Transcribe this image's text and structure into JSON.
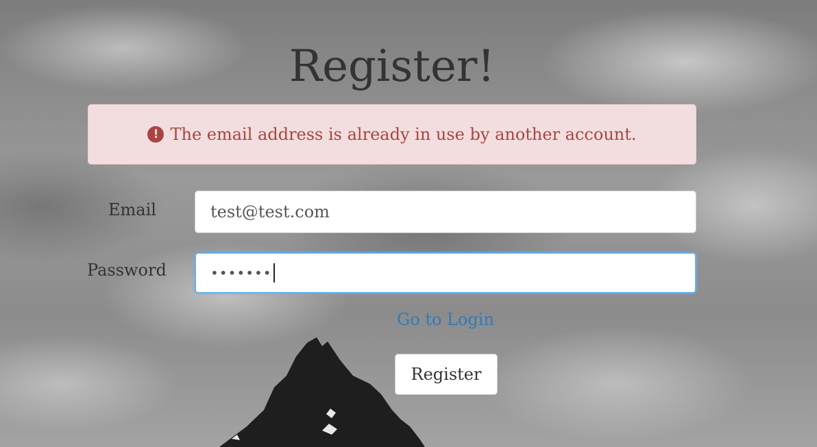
{
  "page": {
    "title": "Register!"
  },
  "alert": {
    "icon": "exclamation-circle-icon",
    "message": "The email address is already in use by another account."
  },
  "form": {
    "email": {
      "label": "Email",
      "value": "test@test.com"
    },
    "password": {
      "label": "Password",
      "masked_value": "•••••••"
    },
    "login_link": "Go to Login",
    "submit_label": "Register"
  },
  "colors": {
    "alert_background": "#f2dede",
    "alert_text": "#a94442",
    "link": "#337ab7",
    "focus_border": "#66afe9"
  }
}
